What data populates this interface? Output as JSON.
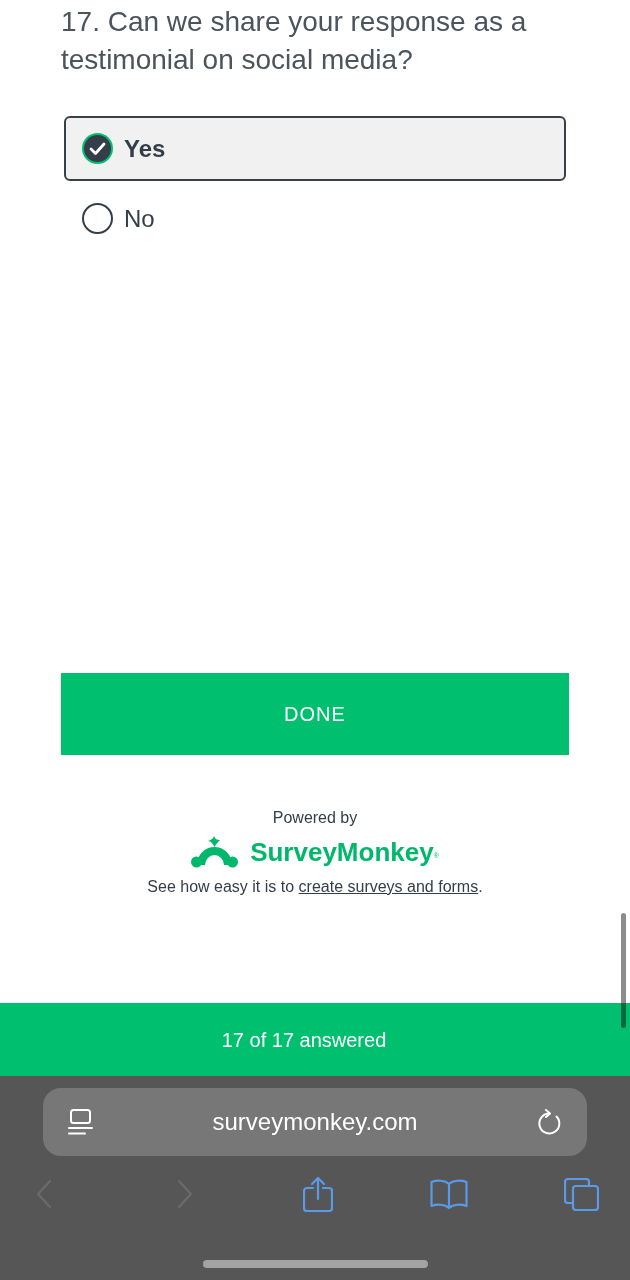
{
  "question": {
    "text": "17. Can we share your response as a testimonial on social media?"
  },
  "options": [
    {
      "label": "Yes",
      "selected": true
    },
    {
      "label": "No",
      "selected": false
    }
  ],
  "done_button": {
    "label": "DONE"
  },
  "footer": {
    "powered_by": "Powered by",
    "brand": "SurveyMonkey$^{®}$",
    "tagline": {
      "text": "See how easy it is to",
      "link": "create surveys and forms",
      "end": "."
    }
  },
  "progress": {
    "text": "17 of 17 answered"
  },
  "browser": {
    "url": "surveymonkey.com",
    "back": {
      "disabled": true
    },
    "forward": {
      "disabled": true
    }
  }
}
